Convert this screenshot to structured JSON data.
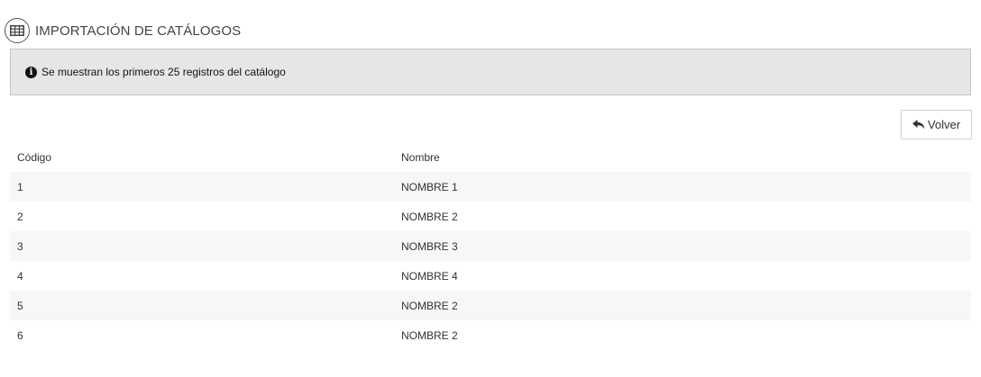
{
  "header": {
    "icon": "table-icon",
    "title": "IMPORTACIÓN DE CATÁLOGOS"
  },
  "info": {
    "icon": "info-circle-icon",
    "text": "Se muestran los primeros 25 registros del catálogo"
  },
  "toolbar": {
    "back_icon": "reply-arrow-icon",
    "back_label": "Volver"
  },
  "table": {
    "columns": [
      "Código",
      "Nombre"
    ],
    "rows": [
      [
        "1",
        "NOMBRE 1"
      ],
      [
        "2",
        "NOMBRE 2"
      ],
      [
        "3",
        "NOMBRE 3"
      ],
      [
        "4",
        "NOMBRE 4"
      ],
      [
        "5",
        "NOMBRE 2"
      ],
      [
        "6",
        "NOMBRE 2"
      ]
    ]
  }
}
